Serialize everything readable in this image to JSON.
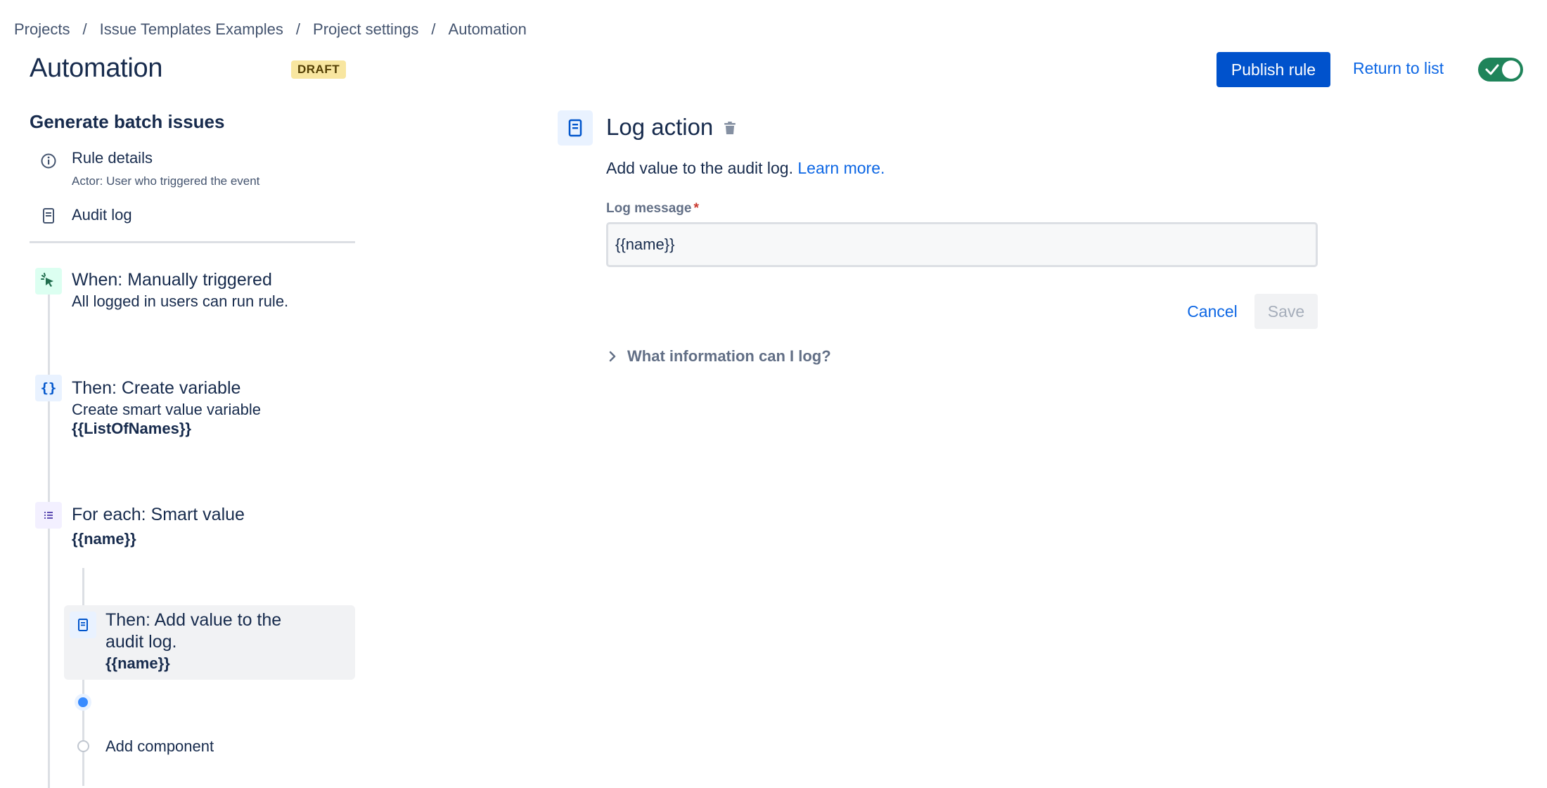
{
  "breadcrumb": {
    "items": [
      "Projects",
      "Issue Templates Examples",
      "Project settings",
      "Automation"
    ],
    "separator": "/"
  },
  "header": {
    "title": "Automation",
    "badge": "DRAFT",
    "publish_label": "Publish rule",
    "return_label": "Return to list",
    "toggle_enabled": true
  },
  "sidebar": {
    "rule_name": "Generate batch issues",
    "rule_details_label": "Rule details",
    "rule_details_sub": "Actor: User who triggered the event",
    "audit_log_label": "Audit log"
  },
  "timeline": {
    "trigger": {
      "title": "When: Manually triggered",
      "desc": "All logged in users can run rule.",
      "icon": "cursor-click-icon"
    },
    "variable": {
      "title": "Then: Create variable",
      "desc": "Create smart value variable",
      "value": "{{ListOfNames}}",
      "icon": "braces-icon"
    },
    "branch": {
      "title": "For each: Smart value",
      "value": "{{name}}",
      "icon": "list-icon"
    },
    "action": {
      "title_line1": "Then: Add value to the",
      "title_line2": "audit log.",
      "value": "{{name}}",
      "icon": "document-icon"
    },
    "add_component_label": "Add component"
  },
  "panel": {
    "title": "Log action",
    "desc": "Add value to the audit log.",
    "learn_more": "Learn more.",
    "field_label": "Log message",
    "required_mark": "*",
    "field_value": "{{name}}",
    "cancel_label": "Cancel",
    "save_label": "Save",
    "expander_label": "What information can I log?"
  },
  "colors": {
    "primary": "#0052cc",
    "link": "#0c66e4",
    "toggle_on": "#1f845a",
    "badge_bg": "#f8e6a0",
    "trigger_icon_bg": "#dcfff1",
    "action_icon_bg": "#e9f2ff",
    "branch_icon_bg": "#f3f0ff"
  }
}
